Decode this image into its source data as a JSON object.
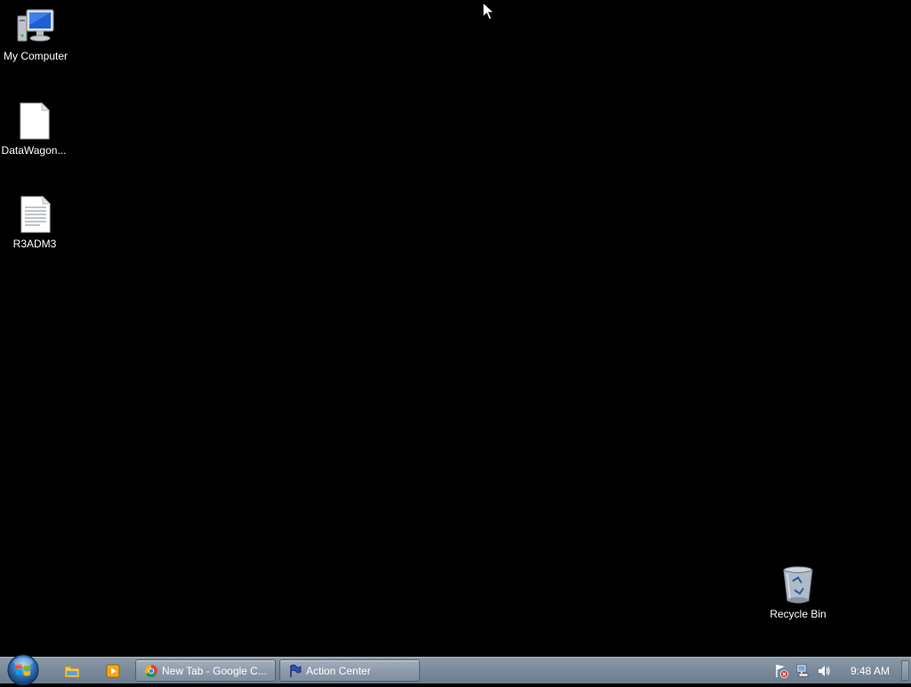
{
  "desktop": {
    "icons": [
      {
        "label": "My Computer",
        "icon": "computer-icon"
      },
      {
        "label": "DataWagon...",
        "icon": "blank-file-icon"
      },
      {
        "label": "R3ADM3",
        "icon": "text-file-icon"
      },
      {
        "label": "Recycle Bin",
        "icon": "recycle-bin-icon"
      }
    ]
  },
  "taskbar": {
    "start_icon": "windows-start-orb-icon",
    "quick_launch": [
      {
        "icon": "windows-explorer-icon"
      },
      {
        "icon": "media-player-icon"
      }
    ],
    "tasks": [
      {
        "label": "New Tab - Google C...",
        "icon": "chrome-icon"
      },
      {
        "label": "Action Center",
        "icon": "action-center-flag-icon"
      }
    ],
    "tray": {
      "icons": [
        "action-center-error-icon",
        "network-icon",
        "volume-icon"
      ],
      "clock": "9:48 AM"
    }
  },
  "colors": {
    "desktop_background": "#000000",
    "taskbar": "#7a8b9c",
    "text": "#ffffff"
  }
}
